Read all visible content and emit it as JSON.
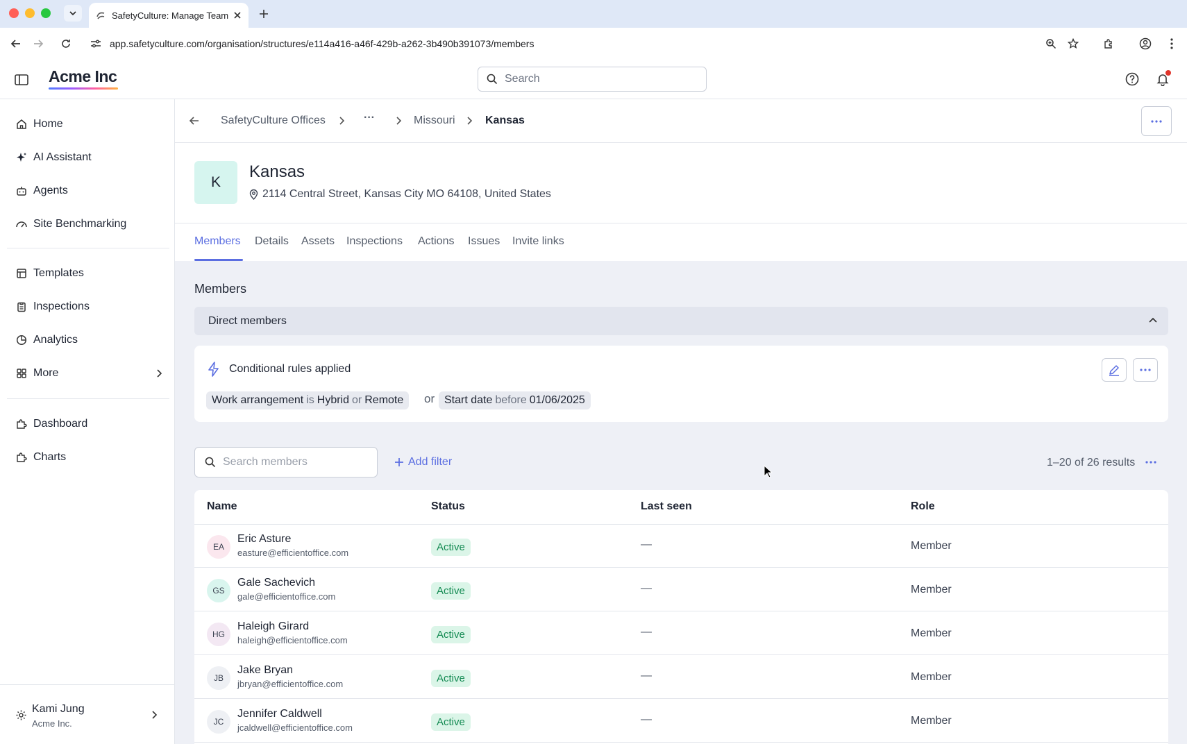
{
  "browser": {
    "tab_title": "SafetyCulture: Manage Teams",
    "url": "app.safetyculture.com/organisation/structures/e114a416-a46f-429b-a262-3b490b391073/members"
  },
  "app": {
    "logo": "Acme Inc",
    "search_placeholder": "Search"
  },
  "sidebar": {
    "items": [
      {
        "label": "Home",
        "icon": "home-icon"
      },
      {
        "label": "AI Assistant",
        "icon": "sparkle-icon"
      },
      {
        "label": "Agents",
        "icon": "robot-icon"
      },
      {
        "label": "Site Benchmarking",
        "icon": "gauge-icon"
      },
      {
        "label": "Templates",
        "icon": "template-icon"
      },
      {
        "label": "Inspections",
        "icon": "clipboard-icon"
      },
      {
        "label": "Analytics",
        "icon": "pie-chart-icon"
      },
      {
        "label": "More",
        "icon": "grid-icon"
      },
      {
        "label": "Dashboard",
        "icon": "puzzle-icon"
      },
      {
        "label": "Charts",
        "icon": "puzzle-icon"
      }
    ],
    "user": {
      "name": "Kami Jung",
      "org": "Acme Inc."
    }
  },
  "breadcrumb": {
    "items": [
      "SafetyCulture Offices",
      "···",
      "Missouri",
      "Kansas"
    ]
  },
  "site": {
    "initial": "K",
    "name": "Kansas",
    "address": "2114 Central Street, Kansas City MO 64108, United States"
  },
  "tabs": [
    "Members",
    "Details",
    "Assets",
    "Inspections",
    "Actions",
    "Issues",
    "Invite links"
  ],
  "members_section": {
    "title": "Members",
    "direct_label": "Direct members",
    "rules": {
      "title": "Conditional rules applied",
      "chip1": {
        "field": "Work arrangement",
        "op": "is",
        "value1": "Hybrid",
        "op2": "or",
        "value2": "Remote"
      },
      "connector": "or",
      "chip2": {
        "field": "Start date",
        "op": "before",
        "value": "01/06/2025"
      }
    },
    "search_placeholder": "Search members",
    "add_filter": "Add filter",
    "results": "1–20 of 26 results"
  },
  "table": {
    "headers": [
      "Name",
      "Status",
      "Last seen",
      "Role"
    ],
    "rows": [
      {
        "initials": "EA",
        "name": "Eric Asture",
        "email": "easture@efficientoffice.com",
        "status": "Active",
        "last_seen": "—",
        "role": "Member",
        "avatar_color": "#fbe7ee"
      },
      {
        "initials": "GS",
        "name": "Gale Sachevich",
        "email": "gale@efficientoffice.com",
        "status": "Active",
        "last_seen": "—",
        "role": "Member",
        "avatar_color": "#d9f5ee"
      },
      {
        "initials": "HG",
        "name": "Haleigh Girard",
        "email": "haleigh@efficientoffice.com",
        "status": "Active",
        "last_seen": "—",
        "role": "Member",
        "avatar_color": "#f3e8f3"
      },
      {
        "initials": "JB",
        "name": "Jake Bryan",
        "email": "jbryan@efficientoffice.com",
        "status": "Active",
        "last_seen": "—",
        "role": "Member",
        "avatar_color": "#eef0f4"
      },
      {
        "initials": "JC",
        "name": "Jennifer Caldwell",
        "email": "jcaldwell@efficientoffice.com",
        "status": "Active",
        "last_seen": "—",
        "role": "Member",
        "avatar_color": "#eef0f4"
      }
    ]
  },
  "colors": {
    "accent": "#5b6ee1",
    "status_active_bg": "#dbf5e8",
    "status_active_text": "#138a52"
  }
}
